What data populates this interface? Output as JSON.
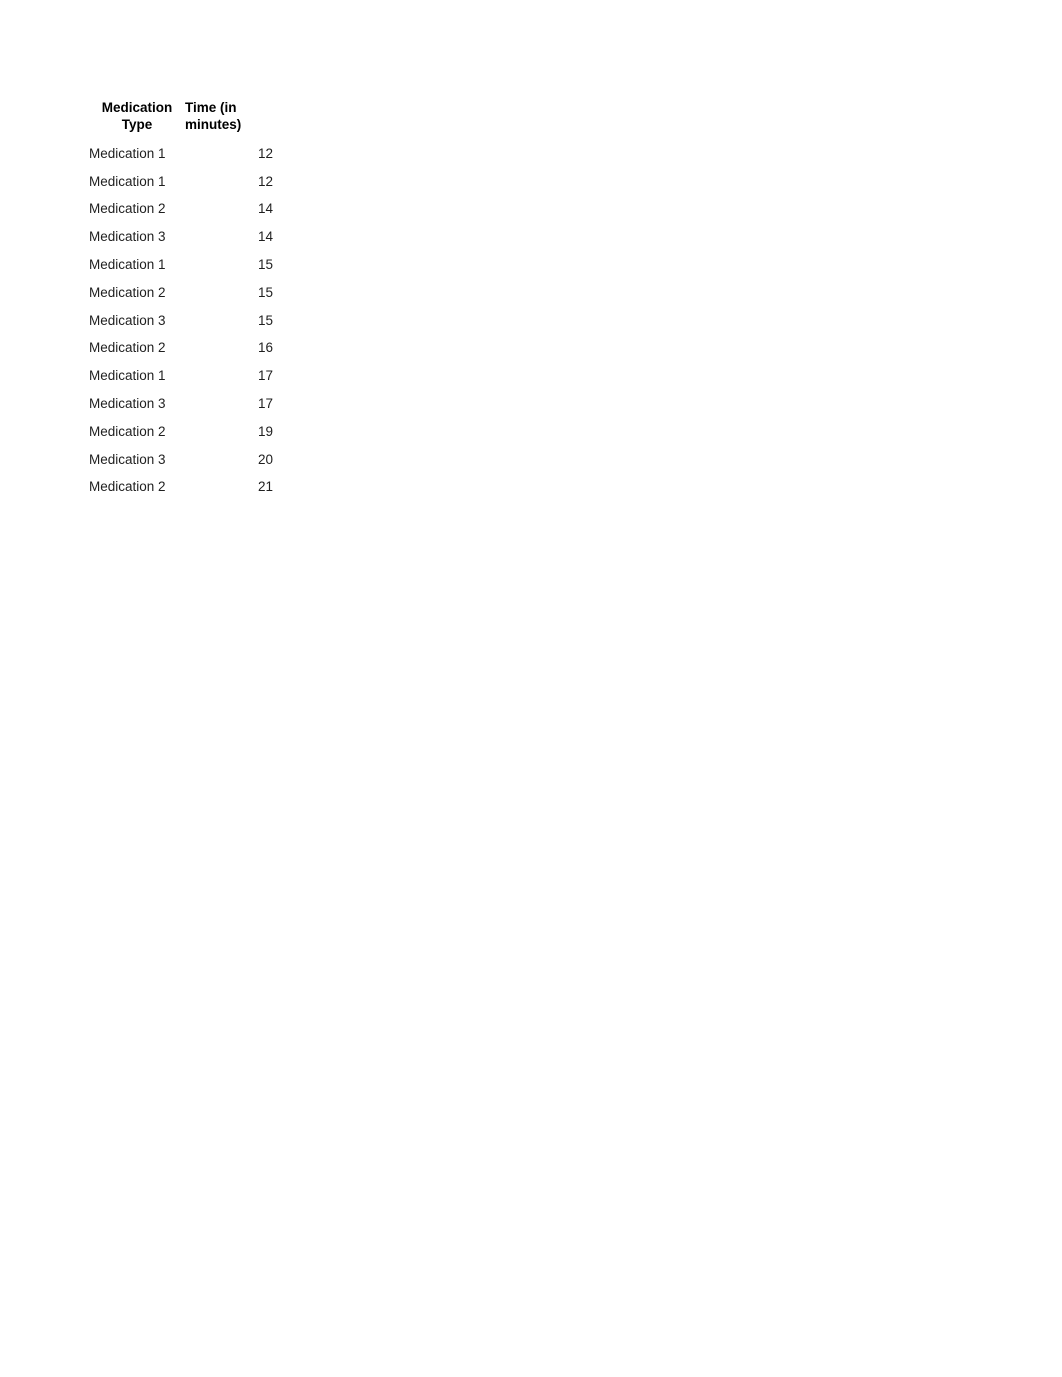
{
  "document": {
    "background_color": "#ffffff",
    "text_color": "#1f1f1f",
    "header_text_color": "#000000"
  },
  "table": {
    "columns": [
      {
        "key": "medication_type",
        "label": "Medication Type",
        "align": "left",
        "header_align": "center"
      },
      {
        "key": "time_minutes",
        "label": "Time (in minutes)",
        "align": "right",
        "header_align": "left"
      }
    ],
    "rows": [
      {
        "medication_type": "Medication 1",
        "time_minutes": "12"
      },
      {
        "medication_type": "Medication 1",
        "time_minutes": "12"
      },
      {
        "medication_type": "Medication 2",
        "time_minutes": "14"
      },
      {
        "medication_type": "Medication 3",
        "time_minutes": "14"
      },
      {
        "medication_type": "Medication 1",
        "time_minutes": "15"
      },
      {
        "medication_type": "Medication 2",
        "time_minutes": "15"
      },
      {
        "medication_type": "Medication 3",
        "time_minutes": "15"
      },
      {
        "medication_type": "Medication 2",
        "time_minutes": "16"
      },
      {
        "medication_type": "Medication 1",
        "time_minutes": "17"
      },
      {
        "medication_type": "Medication 3",
        "time_minutes": "17"
      },
      {
        "medication_type": "Medication 2",
        "time_minutes": "19"
      },
      {
        "medication_type": "Medication 3",
        "time_minutes": "20"
      },
      {
        "medication_type": "Medication 2",
        "time_minutes": "21"
      }
    ]
  },
  "chart_data": {
    "type": "table",
    "title": "",
    "columns": [
      "Medication Type",
      "Time (in minutes)"
    ],
    "categories": [
      "Medication 1",
      "Medication 1",
      "Medication 2",
      "Medication 3",
      "Medication 1",
      "Medication 2",
      "Medication 3",
      "Medication 2",
      "Medication 1",
      "Medication 3",
      "Medication 2",
      "Medication 3",
      "Medication 2"
    ],
    "values": [
      12,
      12,
      14,
      14,
      15,
      15,
      15,
      16,
      17,
      17,
      19,
      20,
      21
    ],
    "xlabel": "Medication Type",
    "ylabel": "Time (in minutes)"
  }
}
